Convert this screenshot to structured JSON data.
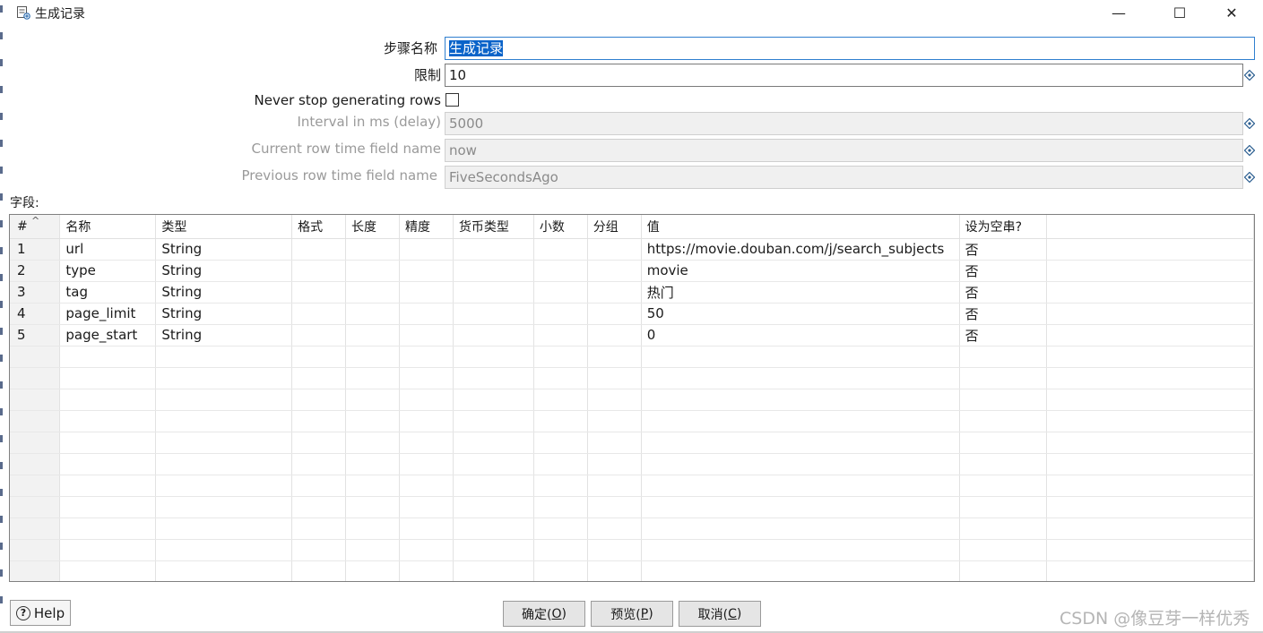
{
  "window": {
    "title": "生成记录",
    "minimize_glyph": "—",
    "maximize_glyph": "☐",
    "close_glyph": "✕"
  },
  "form": {
    "step_name_label": "步骤名称",
    "step_name_value": "生成记录",
    "limit_label": "限制",
    "limit_value": "10",
    "never_stop_label": "Never stop generating rows",
    "never_stop_checked": false,
    "interval_label": "Interval in ms (delay)",
    "interval_value": "5000",
    "current_time_label": "Current row time field name",
    "current_time_value": "now",
    "previous_time_label": "Previous row time field name",
    "previous_time_value": "FiveSecondsAgo"
  },
  "fields": {
    "label": "字段:",
    "sort_indicator": "^",
    "columns": [
      "#",
      "名称",
      "类型",
      "格式",
      "长度",
      "精度",
      "货币类型",
      "小数",
      "分组",
      "值",
      "设为空串?"
    ],
    "rows": [
      [
        "1",
        "url",
        "String",
        "",
        "",
        "",
        "",
        "",
        "",
        "https://movie.douban.com/j/search_subjects",
        "否"
      ],
      [
        "2",
        "type",
        "String",
        "",
        "",
        "",
        "",
        "",
        "",
        "movie",
        "否"
      ],
      [
        "3",
        "tag",
        "String",
        "",
        "",
        "",
        "",
        "",
        "",
        "热门",
        "否"
      ],
      [
        "4",
        "page_limit",
        "String",
        "",
        "",
        "",
        "",
        "",
        "",
        "50",
        "否"
      ],
      [
        "5",
        "page_start",
        "String",
        "",
        "",
        "",
        "",
        "",
        "",
        "0",
        "否"
      ]
    ]
  },
  "buttons": {
    "help": "Help",
    "ok_prefix": "确定(",
    "ok_key": "O",
    "ok_suffix": ")",
    "preview_prefix": "预览(",
    "preview_key": "P",
    "preview_suffix": ")",
    "cancel_prefix": "取消(",
    "cancel_key": "C",
    "cancel_suffix": ")"
  },
  "watermark": "CSDN @像豆芽一样优秀",
  "colors": {
    "selection": "#0a63c9",
    "focus_border": "#2f7fcf",
    "disabled_bg": "#f0f0f0"
  }
}
